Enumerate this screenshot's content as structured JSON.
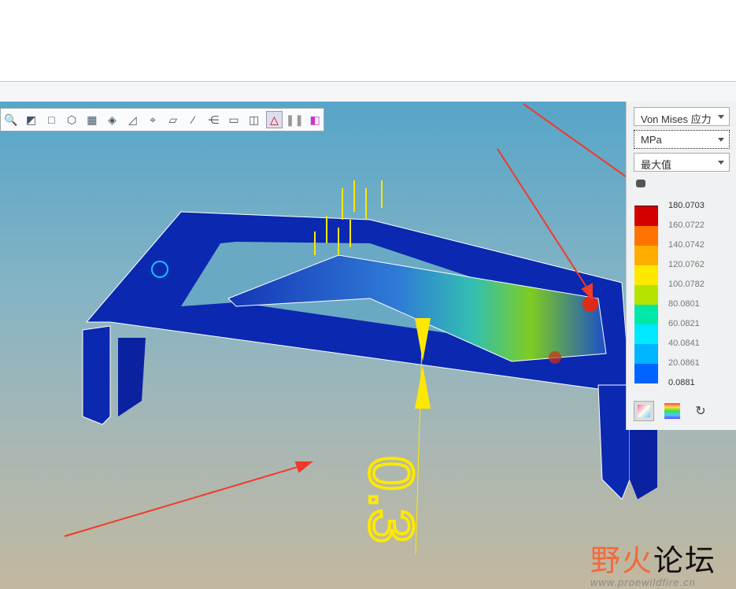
{
  "toolbar": {
    "icons": [
      "zoom-out-icon",
      "refit-icon",
      "saved-orientations-icon",
      "view-manager-icon",
      "screenshot-icon",
      "display-style-icon",
      "section-icon",
      "datum-display-icon",
      "plane-display-icon",
      "axis-display-icon",
      "connections-icon",
      "hide-show-icon",
      "glasses-view-icon",
      "results-display-icon",
      "pause-icon",
      "color-map-icon"
    ]
  },
  "legend": {
    "quantity": "Von Mises 应力",
    "unit": "MPa",
    "mode": "最大值",
    "values": [
      "180.0703",
      "160.0722",
      "140.0742",
      "120.0762",
      "100.0782",
      "80.0801",
      "60.0821",
      "40.0841",
      "20.0861",
      "0.0881"
    ],
    "colors": [
      "#d40000",
      "#ff7400",
      "#ffad00",
      "#ffe800",
      "#b4e400",
      "#00e8a8",
      "#00e8ff",
      "#00b4ff",
      "#0064ff"
    ]
  },
  "annotation": {
    "thickness_label": "0.3"
  },
  "watermark": {
    "name_red": "野火",
    "name_black": "论坛",
    "url": "www.proewildfire.cn"
  }
}
